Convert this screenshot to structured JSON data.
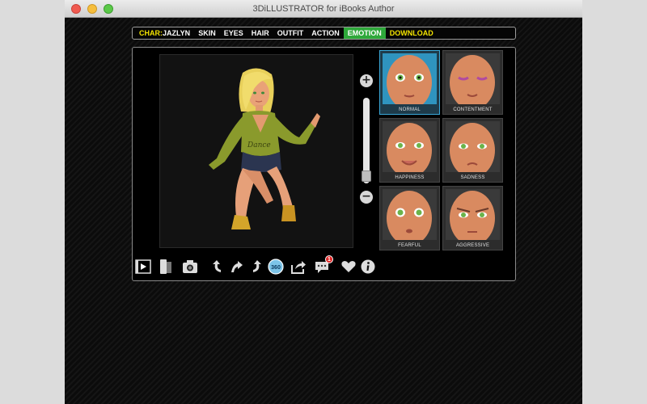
{
  "window": {
    "title": "3DiLLUSTRATOR for iBooks Author"
  },
  "menubar": {
    "char_prefix": "CHAR:",
    "char_name": "JAZLYN",
    "items": [
      "SKIN",
      "EYES",
      "HAIR",
      "OUTFIT",
      "ACTION",
      "EMOTION"
    ],
    "download": "DOWNLOAD",
    "active": "EMOTION"
  },
  "figure": {
    "shirt_text": "Dance"
  },
  "emotions": [
    {
      "label": "NORMAL",
      "selected": true
    },
    {
      "label": "CONTENTMENT",
      "selected": false
    },
    {
      "label": "HAPPINESS",
      "selected": false
    },
    {
      "label": "SADNESS",
      "selected": false
    },
    {
      "label": "FEARFUL",
      "selected": false
    },
    {
      "label": "AGGRESSIVE",
      "selected": false
    }
  ],
  "toolbar": {
    "icons": [
      "play-video-icon",
      "phone-portrait-icon",
      "camera-icon",
      "rotate-left-icon",
      "rotate-up-icon",
      "rotate-right-icon",
      "rotate-360-icon",
      "share-icon",
      "chat-icon",
      "heart-icon",
      "info-icon"
    ],
    "rotate_label": "360",
    "chat_badge": "1"
  },
  "colors": {
    "active_tab": "#2ea83a",
    "accent_yellow": "#f4e400",
    "selection_blue": "#3aa8d8",
    "badge_red": "#e02424"
  }
}
